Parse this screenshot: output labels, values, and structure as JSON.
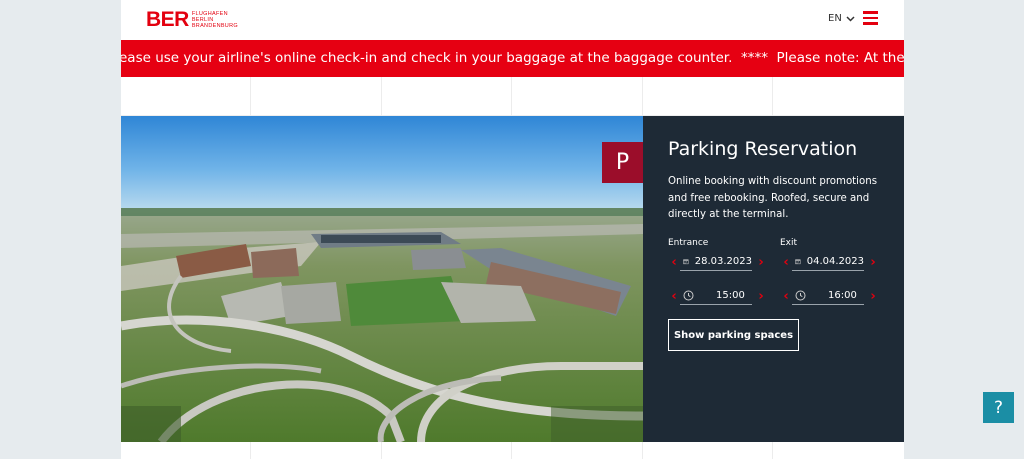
{
  "header": {
    "logo_mark": "BER",
    "logo_sub": [
      "FLUGHAFEN",
      "BERLIN",
      "BRANDENBURG"
    ],
    "language": "EN"
  },
  "ticker": {
    "text": "ease use your airline's online check-in and check in your baggage at the baggage counter.  ****  Please note: At the moment, the self-service"
  },
  "hero": {
    "image": "aerial-airport-photo"
  },
  "parking": {
    "badge": "P",
    "title": "Parking Reservation",
    "description": "Online booking with discount promotions and free rebooking. Roofed, secure and directly at the terminal.",
    "entrance_label": "Entrance",
    "exit_label": "Exit",
    "entrance_date": "28.03.2023",
    "exit_date": "04.04.2023",
    "entrance_time": "15:00",
    "exit_time": "16:00",
    "button_label": "Show parking spaces"
  },
  "help": {
    "label": "?"
  },
  "colors": {
    "brand_red": "#e3000f",
    "ticker_red": "#e60012",
    "panel_bg": "#1e2a36",
    "badge_bg": "#9b0d2a",
    "help_bg": "#1b8ea5"
  }
}
